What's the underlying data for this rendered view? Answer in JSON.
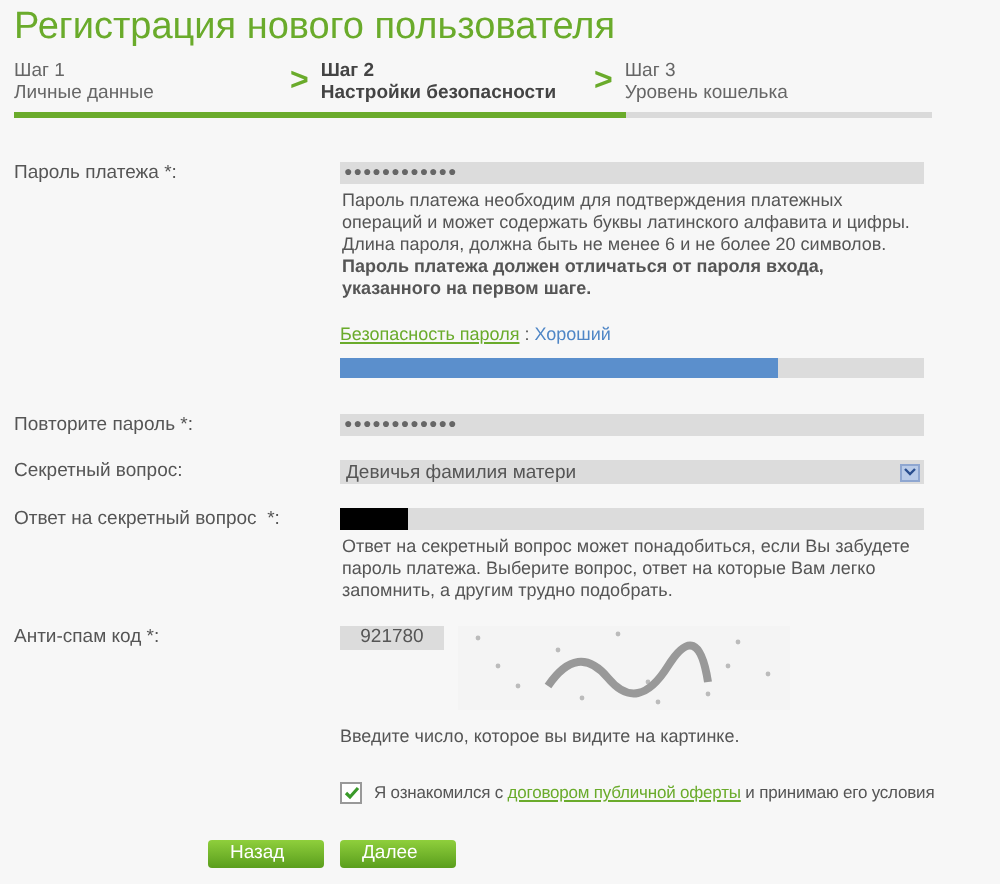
{
  "title": "Регистрация нового пользователя",
  "steps": [
    {
      "number": "Шаг 1",
      "label": "Личные данные",
      "selected": false
    },
    {
      "number": "Шаг 2",
      "label": "Настройки безопасности",
      "selected": true
    },
    {
      "number": "Шаг 3",
      "label": "Уровень кошелька",
      "selected": false
    }
  ],
  "step_separator": ">",
  "progress": {
    "level": 0.667
  },
  "fields": [
    {
      "kind": "password",
      "label": "Пароль платежа *:",
      "value": "●●●●●●●●●●●●",
      "help": "Пароль платежа необходим для подтверждения платежных операций и может содержать буквы латинского алфавита и цифры. Длина пароля, должна быть не менее 6 и не более 20 символов. **Пароль платежа должен отличаться от пароля входа, указанного на первом шаге.**",
      "strength": {
        "link": "Безопасность пароля",
        "separator": " : ",
        "value": "Хороший",
        "level": 0.75
      }
    },
    {
      "kind": "password",
      "label": "Повторите пароль *:",
      "value": "●●●●●●●●●●●●"
    },
    {
      "kind": "select",
      "label": "Секретный вопрос:",
      "value": "Девичья фамилия матери"
    },
    {
      "kind": "answer",
      "label": "Ответ на секретный вопрос  *:",
      "redacted": true,
      "help": "Ответ на секретный вопрос может понадобиться, если Вы забудете пароль платежа. Выберите вопрос, ответ на которые Вам легко запомнить, а другим трудно подобрать."
    },
    {
      "kind": "captcha",
      "label": "Анти-спам код *:",
      "value": "921780",
      "help": "Введите число, которое вы видите на картинке."
    }
  ],
  "agreement": {
    "checked": true,
    "before": "Я ознакомился с ",
    "link": "договором публичной оферты",
    "after": " и принимаю его условия"
  },
  "buttons": [
    "Назад",
    "Далее"
  ]
}
